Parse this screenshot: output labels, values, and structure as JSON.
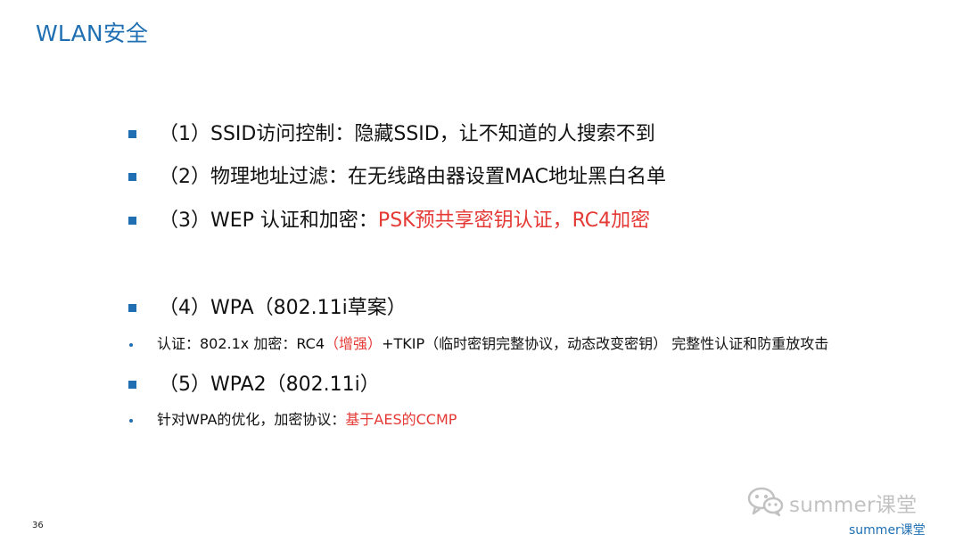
{
  "slide": {
    "title": "WLAN安全",
    "page_number": "36"
  },
  "bullets": [
    {
      "kind": "main",
      "text": "（1）SSID访问控制：隐藏SSID，让不知道的人搜索不到",
      "highlight": ""
    },
    {
      "kind": "main",
      "text": "（2）物理地址过滤：在无线路由器设置MAC地址黑白名单",
      "highlight": ""
    },
    {
      "kind": "main",
      "text": "（3）WEP 认证和加密：",
      "highlight": "PSK预共享密钥认证，RC4加密"
    },
    {
      "kind": "main",
      "text": "（4）WPA（802.11i草案）",
      "highlight": ""
    },
    {
      "kind": "sub",
      "before": "认证：802.1x  加密：RC4",
      "highlight": "（增强）",
      "after": "+TKIP（临时密钥完整协议，动态改变密钥） 完整性认证和防重放攻击"
    },
    {
      "kind": "main",
      "text": "（5）WPA2（802.11i）",
      "highlight": ""
    },
    {
      "kind": "sub",
      "before": "针对WPA的优化，加密协议：",
      "highlight": "基于AES的CCMP",
      "after": ""
    }
  ],
  "watermark": {
    "text": "summer课堂",
    "icon": "wechat-icon"
  },
  "brand": {
    "text": "summer课堂"
  },
  "colors": {
    "accent": "#1f6fb2",
    "highlight": "#e53935",
    "watermark": "#c2c2c2"
  }
}
